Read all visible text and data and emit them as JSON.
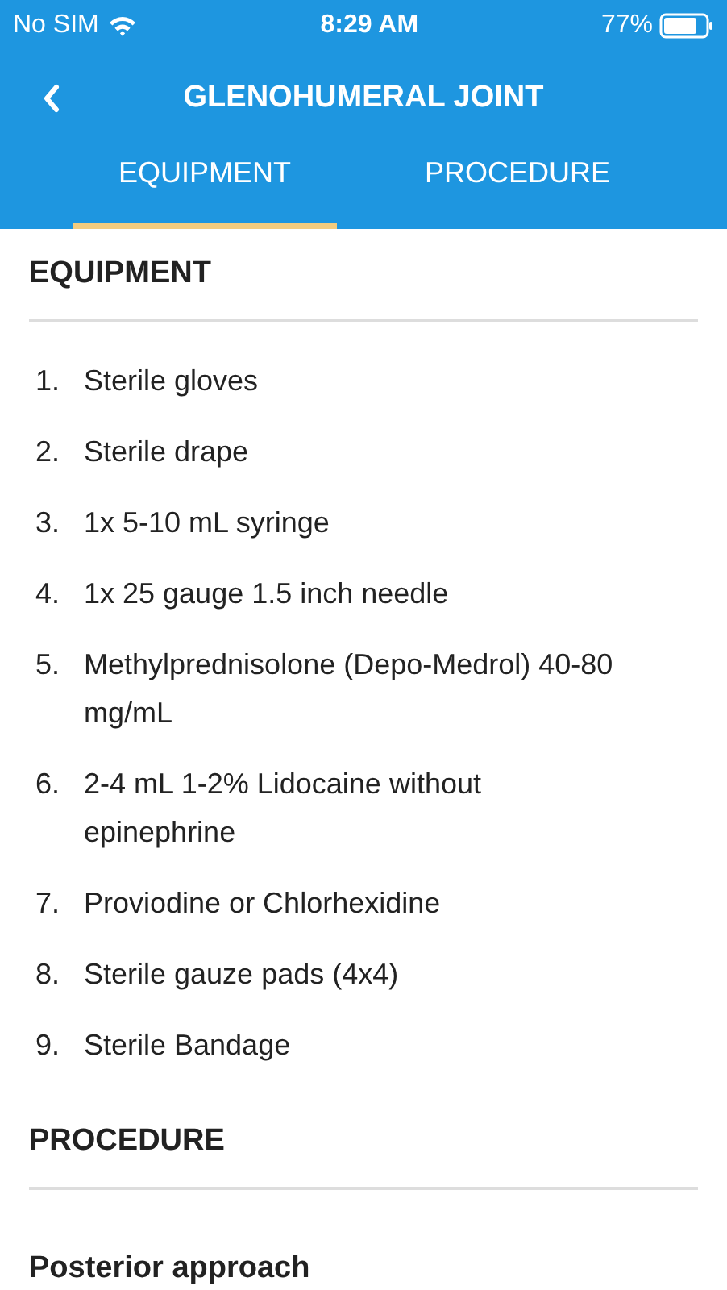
{
  "status_bar": {
    "carrier": "No SIM",
    "time": "8:29 AM",
    "battery": "77%"
  },
  "nav": {
    "title": "GLENOHUMERAL JOINT"
  },
  "tabs": [
    {
      "label": "EQUIPMENT",
      "selected": true
    },
    {
      "label": "PROCEDURE",
      "selected": false
    }
  ],
  "sections": [
    {
      "heading": "EQUIPMENT",
      "items": [
        {
          "number": "1.",
          "text": "Sterile gloves"
        },
        {
          "number": "2.",
          "text": "Sterile drape"
        },
        {
          "number": "3.",
          "text": "1x 5-10 mL syringe"
        },
        {
          "number": "4.",
          "text": "1x 25 gauge 1.5 inch needle"
        },
        {
          "number": "5.",
          "text": "Methylprednisolone (Depo-Medrol) 40-80 mg/mL"
        },
        {
          "number": "6.",
          "text": "2-4 mL 1-2% Lidocaine without epinephrine"
        },
        {
          "number": "7.",
          "text": "Proviodine or Chlorhexidine"
        },
        {
          "number": "8.",
          "text": "Sterile gauze pads (4x4)"
        },
        {
          "number": "9.",
          "text": "Sterile Bandage"
        }
      ]
    },
    {
      "heading": "PROCEDURE",
      "subheading": "Posterior approach"
    }
  ]
}
